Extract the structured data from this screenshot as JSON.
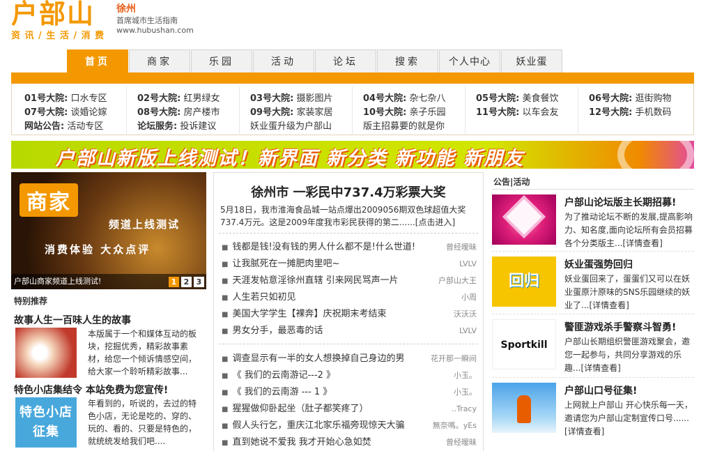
{
  "header": {
    "logo_text": "户部山",
    "slogan": "资 讯 / 生 活 / 消 费",
    "city": "徐州",
    "city_desc": "首席城市生活指南",
    "url": "www.hubushan.com"
  },
  "nav": {
    "tabs": [
      "首页",
      "商家",
      "乐园",
      "活动",
      "论坛",
      "搜索",
      "个人中心",
      "妖业蛋"
    ],
    "active_index": 0
  },
  "forum": {
    "columns": [
      [
        {
          "k": "01号大院:",
          "v": "口水专区"
        },
        {
          "k": "07号大院:",
          "v": "谈婚论嫁"
        },
        {
          "k": "网站公告:",
          "v": "活动专区"
        }
      ],
      [
        {
          "k": "02号大院:",
          "v": "红男绿女"
        },
        {
          "k": "08号大院:",
          "v": "房产楼市"
        },
        {
          "k": "论坛服务:",
          "v": "投诉建议"
        }
      ],
      [
        {
          "k": "03号大院:",
          "v": "摄影图片"
        },
        {
          "k": "09号大院:",
          "v": "家装家居"
        },
        {
          "k": "",
          "v": "妖业蛋升级为户部山"
        }
      ],
      [
        {
          "k": "04号大院:",
          "v": "杂七杂八"
        },
        {
          "k": "10号大院:",
          "v": "亲子乐园"
        },
        {
          "k": "",
          "v": "版主招募要的就是你"
        }
      ],
      [
        {
          "k": "05号大院:",
          "v": "美食餐饮"
        },
        {
          "k": "11号大院:",
          "v": "以车会友"
        }
      ],
      [
        {
          "k": "06号大院:",
          "v": "逛街购物"
        },
        {
          "k": "12号大院:",
          "v": "手机数码"
        }
      ]
    ]
  },
  "banner": {
    "text": "户部山新版上线测试！新界面 新分类 新功能 新朋友"
  },
  "slide": {
    "badge": "商家",
    "line1": "频道上线测试",
    "line2": "消费体验 大众点评",
    "caption": "户部山商家频道上线测试!",
    "pages": [
      "1",
      "2",
      "3"
    ],
    "active_page": 0
  },
  "special": {
    "heading": "特别推荐",
    "items": [
      {
        "title": "故事人生一百味人生的故事",
        "desc": "本版属于一个和媒体互动的板块，挖掘优秀，精彩故事素材，给您一个倾诉情感空间，给大家一个聆听精彩故事..."
      },
      {
        "title": "特色小店集结令 本站免费为您宣传!",
        "desc": "年看到的，听说的，去过的特色小店，无论是吃的、穿的、玩的、看的、只要是特色的，就统统发给我们吧....",
        "thumb_text": "特色小店征集"
      }
    ]
  },
  "headline": {
    "title": "徐州市 一彩民中737.4万彩票大奖",
    "desc": "5月18日，我市淮海食品城一站点爆出2009056期双色球超值大奖737.4万元。这是2009年度我市彩民获得的第二......",
    "more": "[点击进入]"
  },
  "news_group1": [
    {
      "title": "钱都是钱!没有钱的男人什么都不是!什么世道!",
      "author": "曾经暧昧"
    },
    {
      "title": "让我腻死在一摊肥肉里吧~",
      "author": "LVLV"
    },
    {
      "title": "天涯发帖意淫徐州直辖 引来网民骂声一片",
      "author": "户部山大王"
    },
    {
      "title": "人生若只如初见",
      "author": "小周"
    },
    {
      "title": "美国大学学生【裸奔】庆祝期末考结束",
      "author": "沃沃沃"
    },
    {
      "title": "男女分手，最恶毒的话",
      "author": "LVLV"
    }
  ],
  "news_group2": [
    {
      "title": "调查显示有一半的女人想换掉自己身边的男",
      "author": "花开那一瞬间"
    },
    {
      "title": "《 我们的云南游记---2 》",
      "author": "小玉。"
    },
    {
      "title": "《 我们的云南游 --- 1 》",
      "author": "小玉。"
    },
    {
      "title": "猩猩做仰卧起坐（肚子都笑疼了）",
      "author": "..Tracy"
    },
    {
      "title": "假人头行乞，重庆江北家乐福旁现惊天大骗",
      "author": "無奈嗎。yEs"
    },
    {
      "title": "直到她说不爱我 我才开始心急如焚",
      "author": "曾经暧昧"
    }
  ],
  "notices": {
    "heading": "公告|活动",
    "items": [
      {
        "title": "户部山论坛版主长期招募!",
        "desc": "为了推动论坛不断的发展,提高影响力、知名度,面向论坛所有会员招募各个分类版主...[详情查看]"
      },
      {
        "title": "妖业蛋强势回归",
        "desc": "妖业蛋回来了，蛋蛋们又可以在妖业蛋原汁原味的SNS乐园继续的妖业了...[详情查看]",
        "thumb_text": "回归"
      },
      {
        "title": "警匪游戏杀手警察斗智勇!",
        "desc": "户部山长期组织警匪游戏聚会，邀您一起参与，共同分享游戏的乐趣...[详情查看]",
        "thumb_text": "Sportkill"
      },
      {
        "title": "户部山口号征集!",
        "desc": "上网就上户部山 开心快乐每一天，邀请您为户部山定制宣传口号......[详情查看]"
      }
    ]
  },
  "colors": {
    "brand_orange": "#f39800",
    "banner_green": "#c9e000"
  }
}
